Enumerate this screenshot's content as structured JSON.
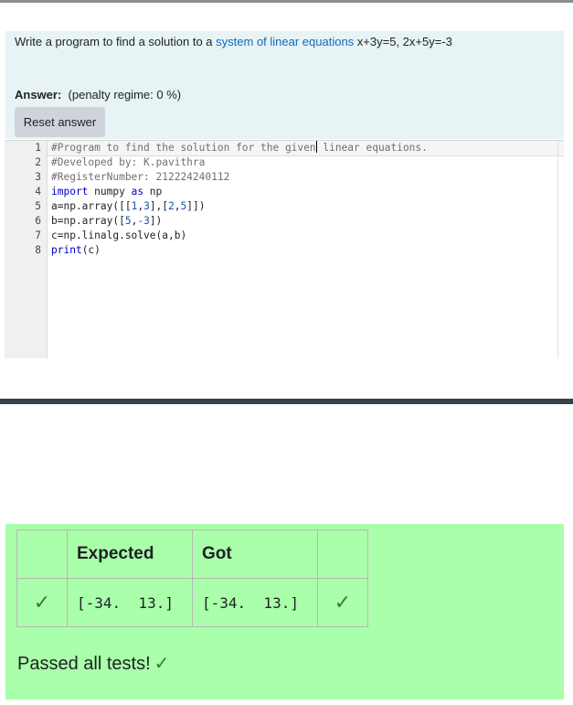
{
  "question": {
    "prefix": "Write a program to find a solution to a ",
    "link": "system of linear equations",
    "suffix": " x+3y=5, 2x+5y=-3"
  },
  "answer": {
    "label": "Answer:",
    "penalty": "(penalty regime: 0 %)"
  },
  "reset_button": "Reset answer",
  "editor": {
    "line_numbers": [
      "1",
      "2",
      "3",
      "4",
      "5",
      "6",
      "7",
      "8"
    ],
    "line1_before_cursor": "#Program to find the solution for the given",
    "line1_after_cursor": " linear equations.",
    "line2": "#Developed by: K.pavithra",
    "line3": "#RegisterNumber: 212224240112",
    "line4_kw1": "import",
    "line4_mid": " numpy ",
    "line4_kw2": "as",
    "line4_end": " np",
    "line5_a": "a=np.array([[",
    "line5_n1": "1",
    "line5_c1": ",",
    "line5_n2": "3",
    "line5_c2": "],[",
    "line5_n3": "2",
    "line5_c3": ",",
    "line5_n4": "5",
    "line5_c4": "]])",
    "line6_a": "b=np.array([",
    "line6_n1": "5",
    "line6_c1": ",",
    "line6_n2": "-3",
    "line6_c2": "])",
    "line7": "c=np.linalg.solve(a,b)",
    "line8_kw": "print",
    "line8_rest": "(c)"
  },
  "results": {
    "headers": [
      "",
      "Expected",
      "Got",
      ""
    ],
    "rows": [
      {
        "status_icon": "check-icon",
        "expected": "[-34.  13.]",
        "got": "[-34.  13.]",
        "result_icon": "check-icon"
      }
    ],
    "check_glyph": "✓",
    "passed_text": "Passed all tests!"
  },
  "colors": {
    "question_bg": "#e7f3f5",
    "link": "#0f6cbf",
    "result_bg": "#aaffaa",
    "check": "#3b7a3b"
  }
}
